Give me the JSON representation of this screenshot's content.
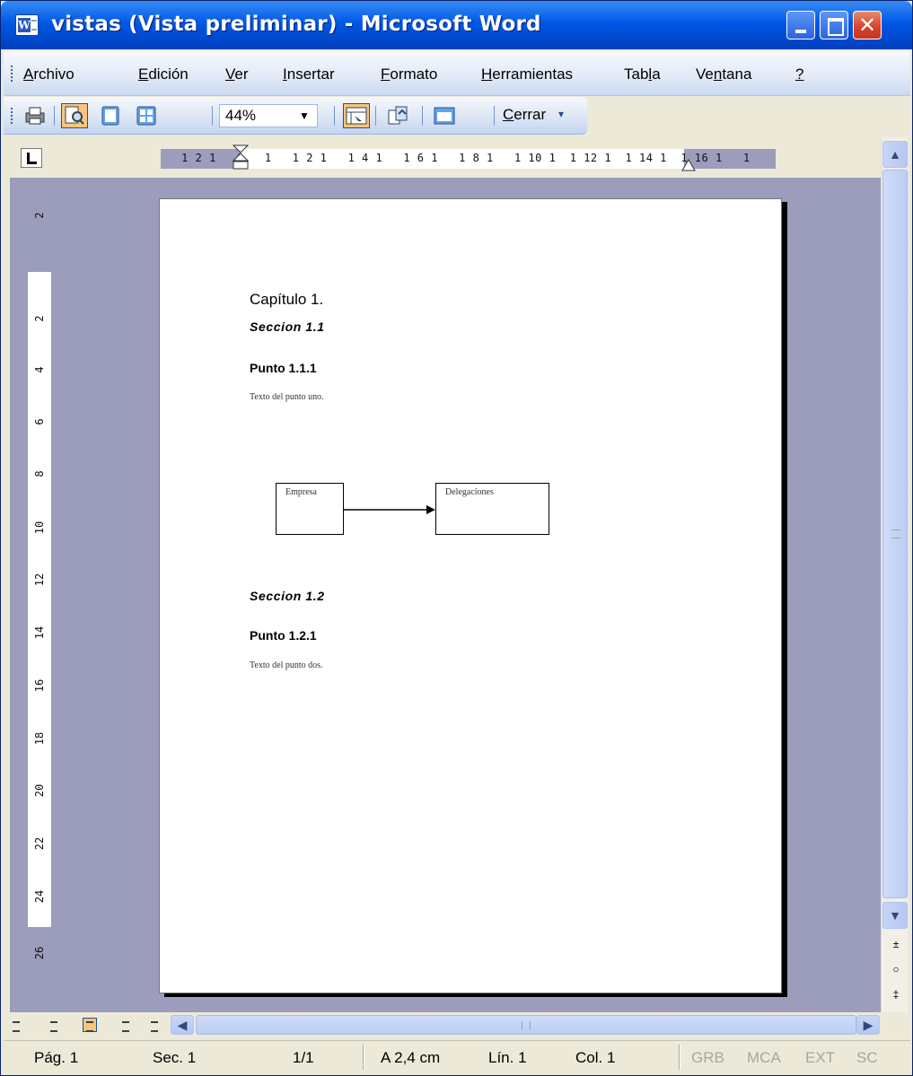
{
  "window": {
    "title": "vistas (Vista preliminar) - Microsoft Word",
    "close_glyph": "✕"
  },
  "menu": [
    {
      "pre": "",
      "key": "A",
      "post": "rchivo"
    },
    {
      "pre": "",
      "key": "E",
      "post": "dición"
    },
    {
      "pre": "",
      "key": "V",
      "post": "er"
    },
    {
      "pre": "",
      "key": "I",
      "post": "nsertar"
    },
    {
      "pre": "",
      "key": "F",
      "post": "ormato"
    },
    {
      "pre": "",
      "key": "H",
      "post": "erramientas"
    },
    {
      "pre": "Tab",
      "key": "l",
      "post": "a"
    },
    {
      "pre": "Ve",
      "key": "n",
      "post": "tana"
    },
    {
      "pre": "",
      "key": "?",
      "post": ""
    }
  ],
  "toolbar": {
    "zoom": "44%",
    "zoom_arrow": "▼",
    "close_key": "C",
    "close_rest": "errar",
    "chevron": "▾",
    "buttons": [
      "print-icon",
      "magnifier-icon",
      "one-page-icon",
      "multiple-pages-icon",
      "view-ruler-icon",
      "shrink-to-fit-icon",
      "full-screen-icon"
    ]
  },
  "ruler": {
    "horizontal": "   1 2 1   1   1   1 2 1   1 4 1   1 6 1   1 8 1   1 10 1  1 12 1  1 14 1  1 16 1   1",
    "vertical": [
      "2",
      "",
      "",
      "2",
      "4",
      "6",
      "8",
      "10",
      "12",
      "14",
      "16",
      "18",
      "20",
      "22",
      "24",
      "26"
    ]
  },
  "document": {
    "heading": "Capítulo 1.",
    "section1": "Seccion 1.1",
    "point1": "Punto 1.1.1",
    "text1": "Texto del punto uno.",
    "box1": "Empresa",
    "box2": "Delegaciones",
    "section2": "Seccion 1.2",
    "point2": "Punto 1.2.1",
    "text2": "Texto del punto dos."
  },
  "scroll": {
    "up": "▲",
    "down": "▼",
    "left": "◀",
    "right": "▶",
    "prev_page": "±",
    "browse_object": "○",
    "next_page": "‡"
  },
  "status": {
    "page": "Pág. 1",
    "section": "Sec. 1",
    "pages": "1/1",
    "at": "A 2,4 cm",
    "line": "Lín. 1",
    "col": "Col. 1",
    "rec": "GRB",
    "trk": "MCA",
    "ext": "EXT",
    "ovr": "SC"
  },
  "colors": {
    "title_bar": "#0058e6",
    "workspace": "#9c9cbc",
    "active_button": "#f7c57b"
  }
}
